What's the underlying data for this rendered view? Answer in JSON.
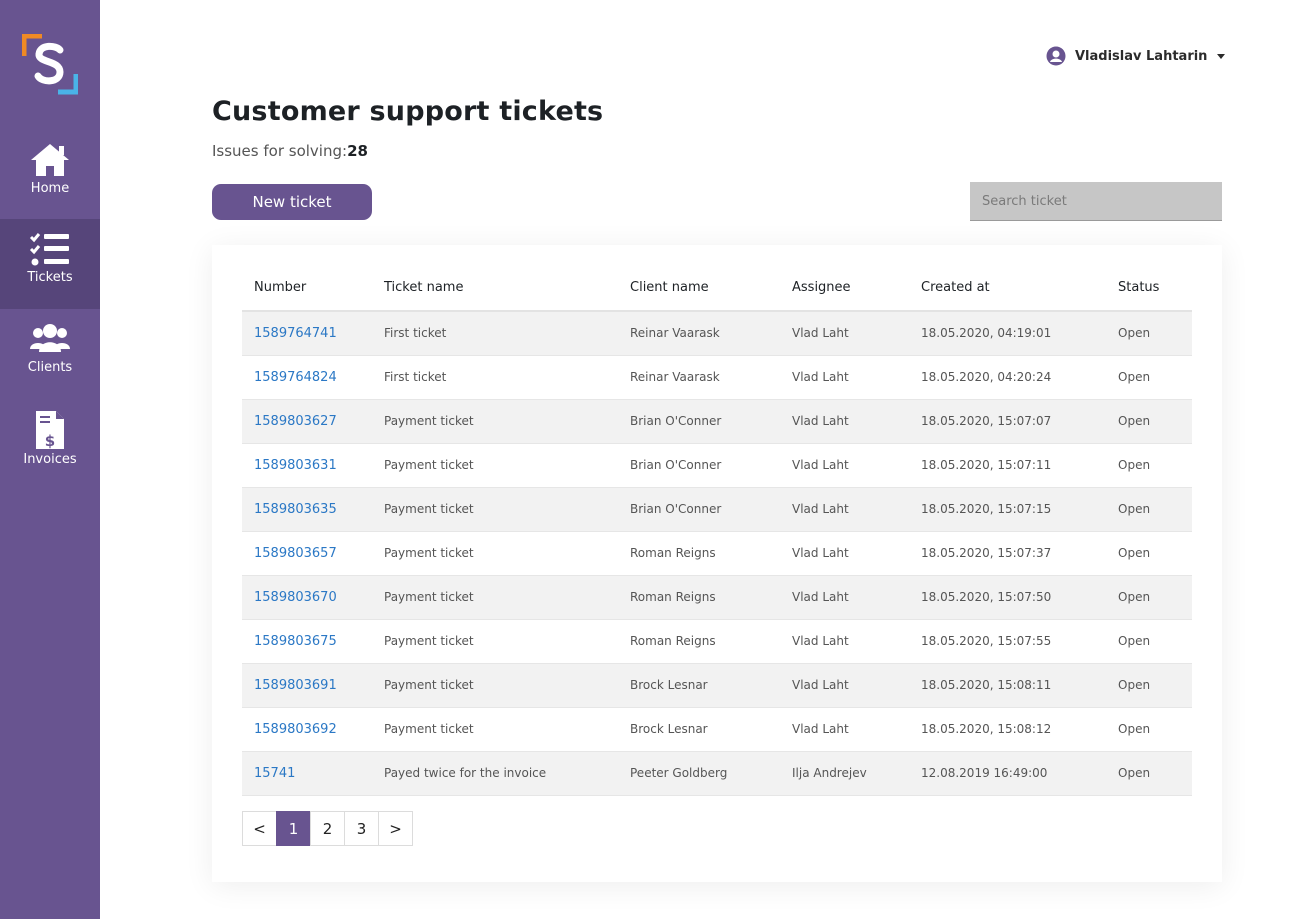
{
  "colors": {
    "accent": "#685490",
    "accent_dark": "#56457a",
    "link": "#2b78c5",
    "logo_orange": "#f08a24",
    "logo_blue": "#4ab3e8"
  },
  "sidebar": {
    "items": [
      {
        "label": "Home",
        "icon": "home-icon",
        "active": false
      },
      {
        "label": "Tickets",
        "icon": "checklist-icon",
        "active": true
      },
      {
        "label": "Clients",
        "icon": "users-icon",
        "active": false
      },
      {
        "label": "Invoices",
        "icon": "invoice-icon",
        "active": false
      }
    ]
  },
  "header": {
    "user_name": "Vladislav Lahtarin",
    "user_icon": "user-circle-icon"
  },
  "main": {
    "title": "Customer support tickets",
    "issues_label": "Issues for solving:",
    "issues_count": "28",
    "new_ticket_label": "New ticket",
    "search_placeholder": "Search ticket"
  },
  "table": {
    "columns": [
      "Number",
      "Ticket name",
      "Client name",
      "Assignee",
      "Created at",
      "Status"
    ],
    "rows": [
      [
        "1589764741",
        "First ticket",
        "Reinar Vaarask",
        "Vlad Laht",
        "18.05.2020, 04:19:01",
        "Open"
      ],
      [
        "1589764824",
        "First ticket",
        "Reinar Vaarask",
        "Vlad Laht",
        "18.05.2020, 04:20:24",
        "Open"
      ],
      [
        "1589803627",
        "Payment ticket",
        "Brian O'Conner",
        "Vlad Laht",
        "18.05.2020, 15:07:07",
        "Open"
      ],
      [
        "1589803631",
        "Payment ticket",
        "Brian O'Conner",
        "Vlad Laht",
        "18.05.2020, 15:07:11",
        "Open"
      ],
      [
        "1589803635",
        "Payment ticket",
        "Brian O'Conner",
        "Vlad Laht",
        "18.05.2020, 15:07:15",
        "Open"
      ],
      [
        "1589803657",
        "Payment ticket",
        "Roman Reigns",
        "Vlad Laht",
        "18.05.2020, 15:07:37",
        "Open"
      ],
      [
        "1589803670",
        "Payment ticket",
        "Roman Reigns",
        "Vlad Laht",
        "18.05.2020, 15:07:50",
        "Open"
      ],
      [
        "1589803675",
        "Payment ticket",
        "Roman Reigns",
        "Vlad Laht",
        "18.05.2020, 15:07:55",
        "Open"
      ],
      [
        "1589803691",
        "Payment ticket",
        "Brock Lesnar",
        "Vlad Laht",
        "18.05.2020, 15:08:11",
        "Open"
      ],
      [
        "1589803692",
        "Payment ticket",
        "Brock Lesnar",
        "Vlad Laht",
        "18.05.2020, 15:08:12",
        "Open"
      ],
      [
        "15741",
        "Payed twice for the invoice",
        "Peeter Goldberg",
        "Ilja Andrejev",
        "12.08.2019 16:49:00",
        "Open"
      ]
    ]
  },
  "pagination": {
    "prev": "<",
    "next": ">",
    "pages": [
      "1",
      "2",
      "3"
    ],
    "current": "1"
  }
}
